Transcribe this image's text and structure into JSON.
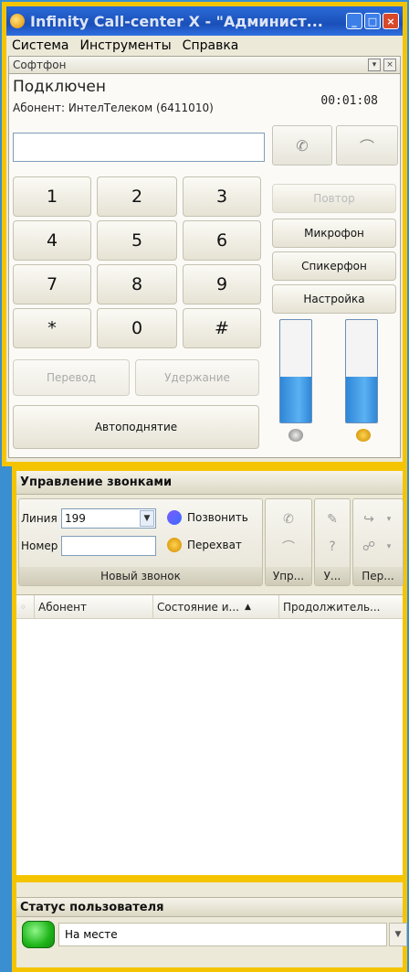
{
  "window": {
    "title": "Infinity Call-center X - \"Администратор\"",
    "title_display": "Infinity Call-center X - \"Админист..."
  },
  "menu": {
    "items": [
      {
        "label": "Система"
      },
      {
        "label": "Инструменты"
      },
      {
        "label": "Справка"
      }
    ]
  },
  "softphone": {
    "header": "Софтфон",
    "status": "Подключен",
    "subscriber": "Абонент: ИнтелТелеком (6411010)",
    "timer": "00:01:08",
    "number_value": "",
    "keys": [
      "1",
      "2",
      "3",
      "4",
      "5",
      "6",
      "7",
      "8",
      "9",
      "*",
      "0",
      "#"
    ],
    "transfer_label": "Перевод",
    "hold_label": "Удержание",
    "autoanswer_label": "Автоподнятие",
    "side_buttons": {
      "repeat": "Повтор",
      "mic": "Микрофон",
      "speaker": "Спикерфон",
      "settings": "Настройка"
    },
    "mic_level": 0.45,
    "speaker_level": 0.45
  },
  "call_control": {
    "header": "Управление звонками",
    "line_label": "Линия",
    "line_value": "199",
    "number_label": "Номер",
    "number_value": "",
    "call_label": "Позвонить",
    "intercept_label": "Перехват",
    "group_new_call": "Новый звонок",
    "group_control": "Упр...",
    "group_u": "У...",
    "group_transfer": "Пер...",
    "columns": [
      "Абонент",
      "Состояние и...",
      "Продолжитель..."
    ]
  },
  "user_status": {
    "header": "Статус пользователя",
    "value": "На месте",
    "color": "#1fb51a"
  },
  "colors": {
    "highlight": "#f5c400",
    "desktop": "#3a8fd0"
  }
}
